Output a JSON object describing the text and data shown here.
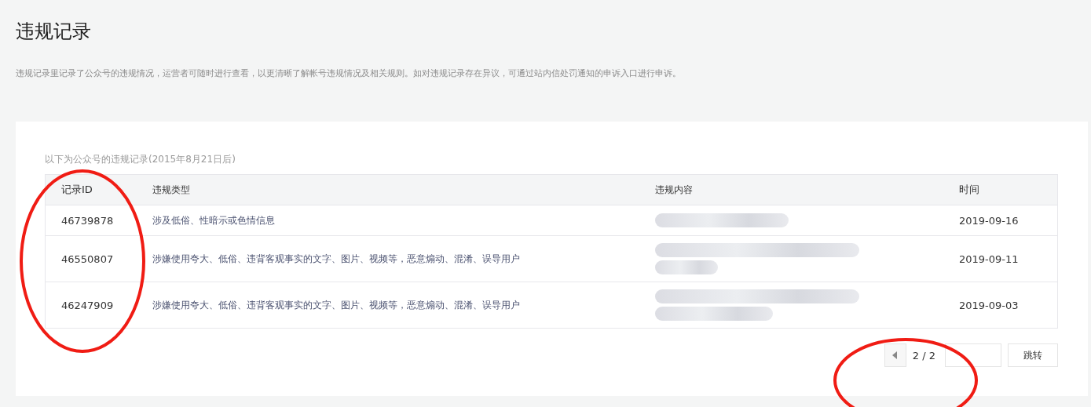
{
  "page": {
    "title": "违规记录",
    "description": "违规记录里记录了公众号的违规情况，运营者可随时进行查看，以更清晰了解帐号违规情况及相关规则。如对违规记录存在异议，可通过站内信处罚通知的申诉入口进行申诉。"
  },
  "table": {
    "caption": "以下为公众号的违规记录(2015年8月21日后)",
    "columns": [
      "记录ID",
      "违规类型",
      "违规内容",
      "时间"
    ],
    "rows": [
      {
        "id": "46739878",
        "type": "涉及低俗、性暗示或色情信息",
        "content_redacted": true,
        "time": "2019-09-16"
      },
      {
        "id": "46550807",
        "type": "涉嫌使用夸大、低俗、违背客观事实的文字、图片、视频等，恶意煽动、混淆、误导用户",
        "content_redacted": true,
        "time": "2019-09-11"
      },
      {
        "id": "46247909",
        "type": "涉嫌使用夸大、低俗、违背客观事实的文字、图片、视频等，恶意煽动、混淆、误导用户",
        "content_redacted": true,
        "time": "2019-09-03"
      }
    ]
  },
  "pagination": {
    "prev_disabled": true,
    "page": "2 / 2",
    "jump_button": "跳转"
  }
}
